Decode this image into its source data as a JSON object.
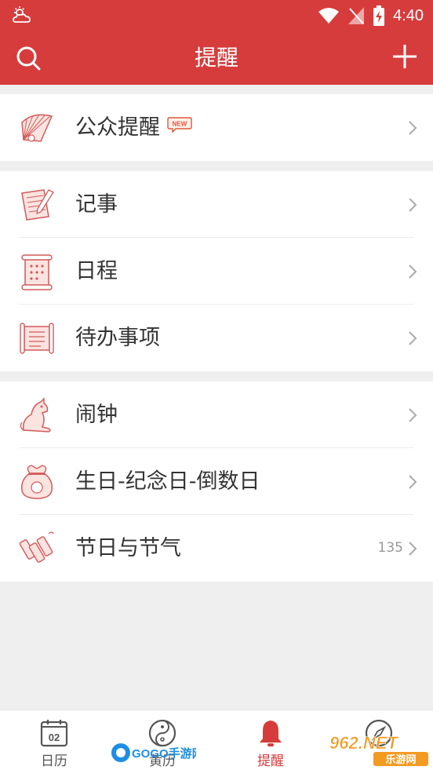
{
  "status_bar": {
    "time": "4:40"
  },
  "app_bar": {
    "title": "提醒"
  },
  "groups": [
    {
      "items": [
        {
          "label": "公众提醒",
          "badge": "NEW"
        }
      ]
    },
    {
      "items": [
        {
          "label": "记事"
        },
        {
          "label": "日程"
        },
        {
          "label": "待办事项"
        }
      ]
    },
    {
      "items": [
        {
          "label": "闹钟"
        },
        {
          "label": "生日-纪念日-倒数日"
        },
        {
          "label": "节日与节气",
          "count": "135"
        }
      ]
    }
  ],
  "tab_bar": {
    "tabs": [
      {
        "label": "日历",
        "icon_text": "02"
      },
      {
        "label": "黄历"
      },
      {
        "label": "提醒",
        "active": true
      },
      {
        "label": ""
      }
    ]
  },
  "watermarks": {
    "left": "GOGO手游网",
    "right_top": "962.NET",
    "right_bottom": "乐游网"
  },
  "colors": {
    "brand_red": "#d63c3c",
    "background": "#efefef",
    "text": "#333333"
  }
}
